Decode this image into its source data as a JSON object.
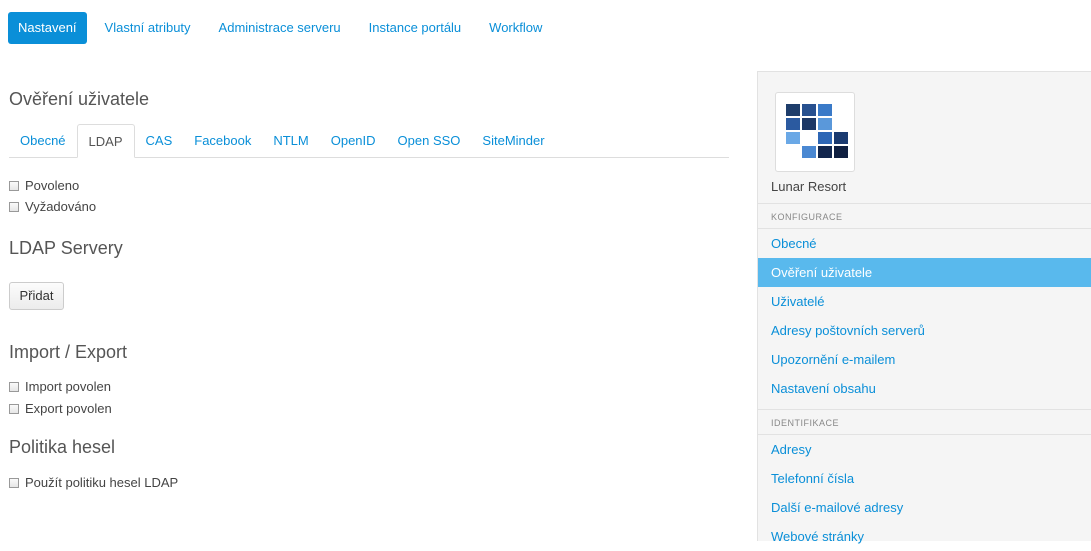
{
  "topnav": {
    "items": [
      "Nastavení",
      "Vlastní atributy",
      "Administrace serveru",
      "Instance portálu",
      "Workflow"
    ]
  },
  "main": {
    "title": "Ověření uživatele",
    "tabs": [
      "Obecné",
      "LDAP",
      "CAS",
      "Facebook",
      "NTLM",
      "OpenID",
      "Open SSO",
      "SiteMinder"
    ],
    "active_tab": "LDAP",
    "enabled_label": "Povoleno",
    "required_label": "Vyžadováno",
    "ldap_servers_title": "LDAP Servery",
    "add_button": "Přidat",
    "import_export_title": "Import / Export",
    "import_label": "Import povolen",
    "export_label": "Export povolen",
    "password_policy_title": "Politika hesel",
    "use_ldap_policy_label": "Použít politiku hesel LDAP"
  },
  "sidebar": {
    "site_name": "Lunar Resort",
    "config_header": "KONFIGURACE",
    "config_items": [
      "Obecné",
      "Ověření uživatele",
      "Uživatelé",
      "Adresy poštovních serverů",
      "Upozornění e-mailem",
      "Nastavení obsahu"
    ],
    "active_item": "Ověření uživatele",
    "ident_header": "IDENTIFIKACE",
    "ident_items": [
      "Adresy",
      "Telefonní čísla",
      "Další e-mailové adresy",
      "Webové stránky"
    ]
  },
  "colors": {
    "accent": "#0a8fd8",
    "active_nav": "#59b9ed"
  }
}
